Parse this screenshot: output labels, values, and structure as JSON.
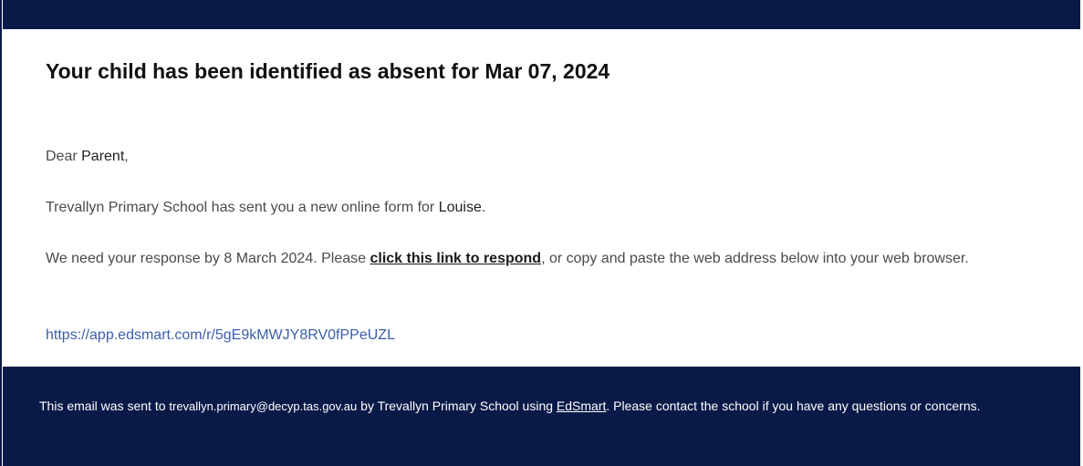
{
  "email": {
    "heading": "Your child has been identified as absent for Mar 07, 2024",
    "greeting": {
      "prefix": "Dear ",
      "name": "Parent",
      "suffix": ","
    },
    "sent_line": {
      "prefix": "Trevallyn Primary School has sent you a new online form for ",
      "student": "Louise",
      "suffix": "."
    },
    "response_line": {
      "prefix": "We need your response by 8 March 2024. Please ",
      "link_text": "click this link to respond",
      "suffix": ", or copy and paste the web address below into your web browser."
    },
    "web_address": "https://app.edsmart.com/r/5gE9kMWJY8RV0fPPeUZL"
  },
  "footer": {
    "prefix": "This email was sent to ",
    "recipient_email": "trevallyn.primary@decyp.tas.gov.au",
    "middle": " by Trevallyn Primary School using ",
    "service_link": "EdSmart",
    "suffix": ". Please contact the school if you have any questions or concerns."
  },
  "colors": {
    "navy": "#0a1a48",
    "link_blue": "#3b5ea8",
    "body_text": "#4a4a4a"
  }
}
